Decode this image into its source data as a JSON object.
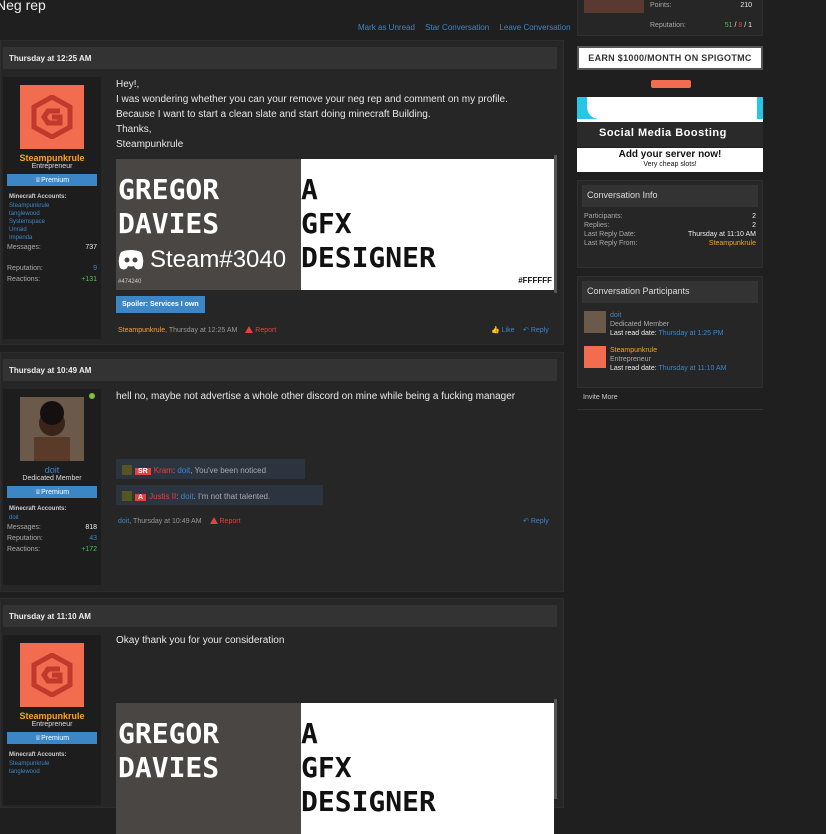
{
  "page": {
    "title": "Neg rep"
  },
  "actions": {
    "mark_unread": "Mark as Unread",
    "star": "Star Conversation",
    "leave": "Leave Conversation"
  },
  "posts": [
    {
      "date": "Thursday at 12:25 AM",
      "user": "Steampunkrule",
      "title": "Entrepreneur",
      "badge": "Premium",
      "mc_label": "Minecraft Accounts:",
      "mc": [
        "Steampunkrule",
        "tanglewood",
        "Systemspace",
        "Unraid",
        "Impenda"
      ],
      "messages_label": "Messages:",
      "messages": "737",
      "rep_label": "Reputation:",
      "rep": "9",
      "react_label": "Reactions:",
      "react": "+131",
      "body": [
        "Hey!,",
        "I was wondering whether you can your remove your neg rep and comment on my profile.",
        "Because I want to start a clean slate and start doing minecraft Building.",
        "Thanks,",
        "Steampunkrule"
      ],
      "spoiler": "Spoiler: Services I own",
      "footer_user": "Steampunkrule",
      "footer_time": ", Thursday at 12:25 AM",
      "report": "Report",
      "like": "Like",
      "reply": "Reply"
    },
    {
      "date": "Thursday at 10:49 AM",
      "user": "doit",
      "title": "Dedicated Member",
      "badge": "Premium",
      "mc_label": "Minecraft Accounts:",
      "mc": [
        "doit"
      ],
      "messages_label": "Messages:",
      "messages": "818",
      "rep_label": "Reputation:",
      "rep": "43",
      "react_label": "Reactions:",
      "react": "+172",
      "body": [
        "hell no, maybe not advertise a whole other discord on mine while being a fucking manager"
      ],
      "q1_tag": "SR",
      "q1_name": "Kram",
      "q1_to": "doit",
      "q1_text": ", You've been noticed",
      "q2_tag": "A",
      "q2_name": "Justis II",
      "q2_to": "doit",
      "q2_text": ". I'm not that talented.",
      "footer_user": "doit",
      "footer_time": ", Thursday at 10:49 AM",
      "report": "Report",
      "reply": "Reply"
    },
    {
      "date": "Thursday at 11:10 AM",
      "user": "Steampunkrule",
      "title": "Entrepreneur",
      "badge": "Premium",
      "mc_label": "Minecraft Accounts:",
      "mc": [
        "Steampunkrule",
        "tanglewood"
      ],
      "body": [
        "Okay thank you for your consideration"
      ]
    }
  ],
  "banner": {
    "l1": "GREGOR",
    "l2": "DAVIES",
    "r1": "A",
    "r2": "GFX",
    "r3": "DESIGNER",
    "discord": "Steam#3040",
    "hex1": "#474240",
    "hex2": "#FFFFFF",
    "colors": {
      "left": "#474240",
      "right": "#FFFFFF"
    }
  },
  "sidebar": {
    "points_label": "Points:",
    "points": "210",
    "rep_label": "Reputation:",
    "rep_pos": "51",
    "rep_neu": "8",
    "rep_neg": "1",
    "ad1": "EARN $1000/MONTH ON SPIGOTMC",
    "ad3": "Social Media Boosting",
    "ad4_main": "Add your server now!",
    "ad4_sub": "Very cheap slots!",
    "info": {
      "heading": "Conversation Info",
      "participants_label": "Participants:",
      "participants": "2",
      "replies_label": "Replies:",
      "replies": "2",
      "last_date_label": "Last Reply Date:",
      "last_date": "Thursday at 11:10 AM",
      "last_from_label": "Last Reply From:",
      "last_from": "Steampunkrule"
    },
    "parts": {
      "heading": "Conversation Participants",
      "p1_name": "doit",
      "p1_title": "Dedicated Member",
      "p1_read_label": "Last read date:",
      "p1_read": "Thursday at 1:25 PM",
      "p2_name": "Steampunkrule",
      "p2_title": "Entrepreneur",
      "p2_read_label": "Last read date:",
      "p2_read": "Thursday at 11:10 AM"
    },
    "invite": "Invite More"
  },
  "colors": {
    "accent": "#3d86c6",
    "username": "#f5a623",
    "report": "#e0443e",
    "positive": "#5fb85f"
  }
}
